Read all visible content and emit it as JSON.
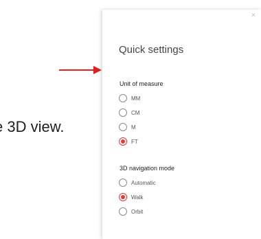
{
  "body_text": "e 3D view.",
  "colors": {
    "arrow": "#e02020",
    "accent": "#e53935"
  },
  "gear_icon": "gear-icon",
  "panel": {
    "close_icon": "close-icon",
    "title": "Quick settings",
    "unit_section": {
      "label": "Unit of measure",
      "options": [
        "MM",
        "CM",
        "M",
        "FT"
      ],
      "selected": "FT"
    },
    "nav_section": {
      "label": "3D navigation mode",
      "options": [
        "Automatic",
        "Walk",
        "Orbit"
      ],
      "selected": "Walk"
    }
  }
}
